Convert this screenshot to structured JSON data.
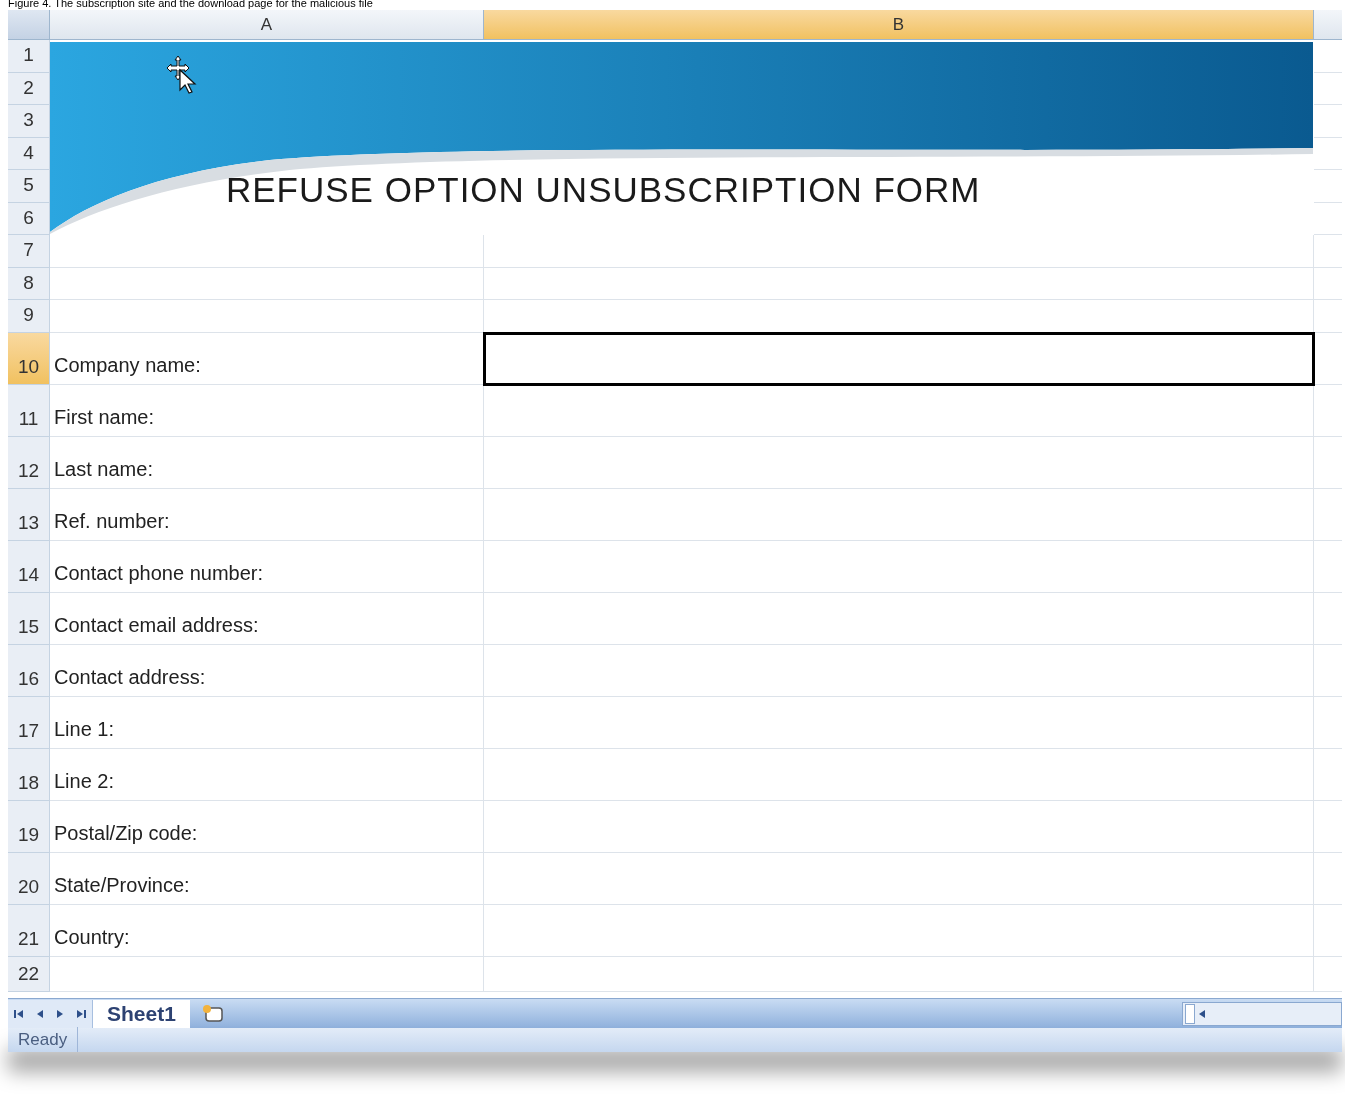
{
  "caption": "Figure 4. The subscription site and the download page for the malicious file",
  "columns": [
    {
      "label": "A",
      "selected": false
    },
    {
      "label": "B",
      "selected": true
    }
  ],
  "banner": {
    "title": "REFUSE OPTION UNSUBSCRIPTION FORM"
  },
  "rows": [
    {
      "number": "1",
      "label": "",
      "selected": false
    },
    {
      "number": "2",
      "label": "",
      "selected": false
    },
    {
      "number": "3",
      "label": "",
      "selected": false
    },
    {
      "number": "4",
      "label": "",
      "selected": false
    },
    {
      "number": "5",
      "label": "",
      "selected": false
    },
    {
      "number": "6",
      "label": "",
      "selected": false
    },
    {
      "number": "7",
      "label": "",
      "selected": false
    },
    {
      "number": "8",
      "label": "",
      "selected": false
    },
    {
      "number": "9",
      "label": "",
      "selected": false
    },
    {
      "number": "10",
      "label": "Company name:",
      "selected": true
    },
    {
      "number": "11",
      "label": "First name:",
      "selected": false
    },
    {
      "number": "12",
      "label": "Last name:",
      "selected": false
    },
    {
      "number": "13",
      "label": "Ref. number:",
      "selected": false
    },
    {
      "number": "14",
      "label": "Contact phone number:",
      "selected": false
    },
    {
      "number": "15",
      "label": "Contact email address:",
      "selected": false
    },
    {
      "number": "16",
      "label": "Contact address:",
      "selected": false
    },
    {
      "number": "17",
      "label": "Line 1:",
      "selected": false
    },
    {
      "number": "18",
      "label": "Line 2:",
      "selected": false
    },
    {
      "number": "19",
      "label": "Postal/Zip code:",
      "selected": false
    },
    {
      "number": "20",
      "label": "State/Province:",
      "selected": false
    },
    {
      "number": "21",
      "label": "Country:",
      "selected": false
    },
    {
      "number": "22",
      "label": "",
      "selected": false
    }
  ],
  "sheet_tabs": [
    {
      "label": "Sheet1",
      "selected": true
    }
  ],
  "status_bar": {
    "text": "Ready"
  }
}
